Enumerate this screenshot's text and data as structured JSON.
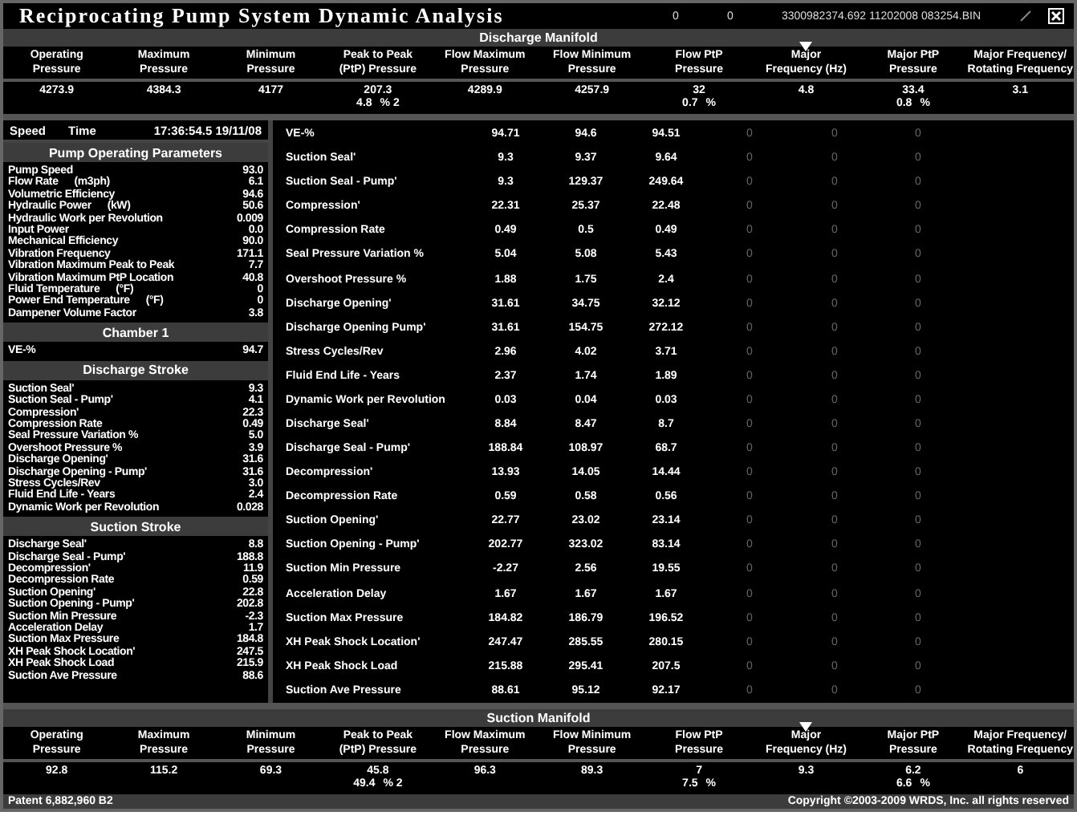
{
  "header": {
    "title": "Reciprocating Pump System Dynamic Analysis",
    "counter_1": "0",
    "counter_2": "0",
    "file": "3300982374.692 11202008 083254.BIN"
  },
  "discharge_manifold": {
    "title": "Discharge Manifold",
    "columns": [
      {
        "label": "Operating",
        "label_2": "Pressure",
        "marked": false,
        "value": "4273.9"
      },
      {
        "label": "Maximum",
        "label_2": "Pressure",
        "marked": false,
        "value": "4384.3"
      },
      {
        "label": "Minimum",
        "label_2": "Pressure",
        "marked": false,
        "value": "4177"
      },
      {
        "label": "Peak to Peak",
        "label_2": "(PtP) Pressure",
        "marked": false,
        "value": "207.3",
        "sub": "4.8",
        "sub_unit": "% 2"
      },
      {
        "label": "Flow Maximum",
        "label_2": "Pressure",
        "marked": false,
        "value": "4289.9"
      },
      {
        "label": "Flow Minimum",
        "label_2": "Pressure",
        "marked": false,
        "value": "4257.9"
      },
      {
        "label": "Flow PtP",
        "label_2": "Pressure",
        "marked": false,
        "value": "32",
        "sub": "0.7",
        "sub_unit": "%"
      },
      {
        "label": "Major",
        "label_2": "Frequency (Hz)",
        "marked": true,
        "value": "4.8"
      },
      {
        "label": "Major PtP",
        "label_2": "Pressure",
        "marked": false,
        "value": "33.4",
        "sub": "0.8",
        "sub_unit": "%"
      },
      {
        "label": "Major Frequency/",
        "label_2": "Rotating Frequency",
        "marked": false,
        "value": "3.1"
      }
    ]
  },
  "status": {
    "speed_label": "Speed",
    "time_label": "Time",
    "time": "17:36:54.5 19/11/08"
  },
  "sections": [
    {
      "title": "Pump Operating Parameters",
      "items": [
        {
          "name": "Pump Speed",
          "value": "93.0"
        },
        {
          "name": "Flow Rate",
          "unit": "(m3ph)",
          "value": "6.1"
        },
        {
          "name": "Volumetric Efficiency",
          "value": "94.6"
        },
        {
          "name": "Hydraulic Power",
          "unit": "(kW)",
          "value": "50.6"
        },
        {
          "name": "Hydraulic Work per Revolution",
          "value": "0.009"
        },
        {
          "name": "Input Power",
          "value": "0.0"
        },
        {
          "name": "Mechanical Efficiency",
          "value": "90.0"
        },
        {
          "name": "Vibration Frequency",
          "value": "171.1"
        },
        {
          "name": "Vibration Maximum Peak to Peak",
          "value": "7.7"
        },
        {
          "name": "Vibration Maximum PtP Location",
          "value": "40.8"
        },
        {
          "name": "Fluid Temperature",
          "unit": "(°F)",
          "value": "0"
        },
        {
          "name": "Power End Temperature",
          "unit": "(°F)",
          "value": "0"
        },
        {
          "name": "Dampener Volume Factor",
          "value": "3.8"
        }
      ]
    },
    {
      "title": "Chamber 1",
      "items": [
        {
          "name": "VE-%",
          "value": "94.7"
        }
      ]
    },
    {
      "title": "Discharge Stroke",
      "items": [
        {
          "name": "Suction Seal'",
          "value": "9.3"
        },
        {
          "name": "Suction Seal - Pump'",
          "value": "4.1"
        },
        {
          "name": "Compression'",
          "value": "22.3"
        },
        {
          "name": "Compression Rate",
          "value": "0.49"
        },
        {
          "name": "Seal Pressure Variation %",
          "value": "5.0"
        },
        {
          "name": "Overshoot Pressure %",
          "value": "3.9"
        },
        {
          "name": "Discharge Opening'",
          "value": "31.6"
        },
        {
          "name": "Discharge Opening - Pump'",
          "value": "31.6"
        },
        {
          "name": "Stress Cycles/Rev",
          "value": "3.0"
        },
        {
          "name": "Fluid End Life - Years",
          "value": "2.4"
        },
        {
          "name": "Dynamic Work per Revolution",
          "value": "0.028"
        }
      ]
    },
    {
      "title": "Suction Stroke",
      "items": [
        {
          "name": "Discharge Seal'",
          "value": "8.8"
        },
        {
          "name": "Discharge Seal - Pump'",
          "value": "188.8"
        },
        {
          "name": "Decompression'",
          "value": "11.9"
        },
        {
          "name": "Decompression Rate",
          "value": "0.59"
        },
        {
          "name": "Suction Opening'",
          "value": "22.8"
        },
        {
          "name": "Suction Opening - Pump'",
          "value": "202.8"
        },
        {
          "name": "Suction Min Pressure",
          "value": "-2.3"
        },
        {
          "name": "Acceleration Delay",
          "value": "1.7"
        },
        {
          "name": "Suction Max Pressure",
          "value": "184.8"
        },
        {
          "name": "XH Peak Shock Location'",
          "value": "247.5"
        },
        {
          "name": "XH Peak Shock Load",
          "value": "215.9"
        },
        {
          "name": "Suction Ave Pressure",
          "value": "88.6"
        }
      ]
    }
  ],
  "table_rows": [
    {
      "name": "VE-%",
      "values": [
        "94.71",
        "94.6",
        "94.51",
        "0",
        "0",
        "0"
      ]
    },
    {
      "name": "Suction Seal'",
      "values": [
        "9.3",
        "9.37",
        "9.64",
        "0",
        "0",
        "0"
      ]
    },
    {
      "name": "Suction Seal - Pump'",
      "values": [
        "9.3",
        "129.37",
        "249.64",
        "0",
        "0",
        "0"
      ]
    },
    {
      "name": "Compression'",
      "values": [
        "22.31",
        "25.37",
        "22.48",
        "0",
        "0",
        "0"
      ]
    },
    {
      "name": "Compression Rate",
      "values": [
        "0.49",
        "0.5",
        "0.49",
        "0",
        "0",
        "0"
      ]
    },
    {
      "name": "Seal Pressure Variation %",
      "values": [
        "5.04",
        "5.08",
        "5.43",
        "0",
        "0",
        "0"
      ]
    },
    {
      "name": "Overshoot Pressure %",
      "values": [
        "1.88",
        "1.75",
        "2.4",
        "0",
        "0",
        "0"
      ]
    },
    {
      "name": "Discharge Opening'",
      "values": [
        "31.61",
        "34.75",
        "32.12",
        "0",
        "0",
        "0"
      ]
    },
    {
      "name": "Discharge Opening Pump'",
      "values": [
        "31.61",
        "154.75",
        "272.12",
        "0",
        "0",
        "0"
      ]
    },
    {
      "name": "Stress Cycles/Rev",
      "values": [
        "2.96",
        "4.02",
        "3.71",
        "0",
        "0",
        "0"
      ]
    },
    {
      "name": "Fluid End Life - Years",
      "values": [
        "2.37",
        "1.74",
        "1.89",
        "0",
        "0",
        "0"
      ]
    },
    {
      "name": "Dynamic Work per Revolution",
      "values": [
        "0.03",
        "0.04",
        "0.03",
        "0",
        "0",
        "0"
      ]
    },
    {
      "name": "Discharge Seal'",
      "values": [
        "8.84",
        "8.47",
        "8.7",
        "0",
        "0",
        "0"
      ]
    },
    {
      "name": "Discharge Seal - Pump'",
      "values": [
        "188.84",
        "108.97",
        "68.7",
        "0",
        "0",
        "0"
      ]
    },
    {
      "name": "Decompression'",
      "values": [
        "13.93",
        "14.05",
        "14.44",
        "0",
        "0",
        "0"
      ]
    },
    {
      "name": "Decompression Rate",
      "values": [
        "0.59",
        "0.58",
        "0.56",
        "0",
        "0",
        "0"
      ]
    },
    {
      "name": "Suction Opening'",
      "values": [
        "22.77",
        "23.02",
        "23.14",
        "0",
        "0",
        "0"
      ]
    },
    {
      "name": "Suction Opening - Pump'",
      "values": [
        "202.77",
        "323.02",
        "83.14",
        "0",
        "0",
        "0"
      ]
    },
    {
      "name": "Suction Min Pressure",
      "values": [
        "-2.27",
        "2.56",
        "19.55",
        "0",
        "0",
        "0"
      ]
    },
    {
      "name": "Acceleration Delay",
      "values": [
        "1.67",
        "1.67",
        "1.67",
        "0",
        "0",
        "0"
      ]
    },
    {
      "name": "Suction Max Pressure",
      "values": [
        "184.82",
        "186.79",
        "196.52",
        "0",
        "0",
        "0"
      ]
    },
    {
      "name": "XH Peak Shock Location'",
      "values": [
        "247.47",
        "285.55",
        "280.15",
        "0",
        "0",
        "0"
      ]
    },
    {
      "name": "XH Peak Shock Load",
      "values": [
        "215.88",
        "295.41",
        "207.5",
        "0",
        "0",
        "0"
      ]
    },
    {
      "name": "Suction Ave Pressure",
      "values": [
        "88.61",
        "95.12",
        "92.17",
        "0",
        "0",
        "0"
      ]
    }
  ],
  "suction_manifold": {
    "title": "Suction Manifold",
    "columns": [
      {
        "label": "Operating",
        "label_2": "Pressure",
        "marked": false,
        "value": "92.8"
      },
      {
        "label": "Maximum",
        "label_2": "Pressure",
        "marked": false,
        "value": "115.2"
      },
      {
        "label": "Minimum",
        "label_2": "Pressure",
        "marked": false,
        "value": "69.3"
      },
      {
        "label": "Peak to Peak",
        "label_2": "(PtP) Pressure",
        "marked": false,
        "value": "45.8",
        "sub": "49.4",
        "sub_unit": "% 2"
      },
      {
        "label": "Flow Maximum",
        "label_2": "Pressure",
        "marked": false,
        "value": "96.3"
      },
      {
        "label": "Flow Minimum",
        "label_2": "Pressure",
        "marked": false,
        "value": "89.3"
      },
      {
        "label": "Flow PtP",
        "label_2": "Pressure",
        "marked": false,
        "value": "7",
        "sub": "7.5",
        "sub_unit": "%"
      },
      {
        "label": "Major",
        "label_2": "Frequency (Hz)",
        "marked": true,
        "value": "9.3"
      },
      {
        "label": "Major PtP",
        "label_2": "Pressure",
        "marked": false,
        "value": "6.2",
        "sub": "6.6",
        "sub_unit": "%"
      },
      {
        "label": "Major Frequency/",
        "label_2": "Rotating Frequency",
        "marked": false,
        "value": "6"
      }
    ]
  },
  "footer": {
    "patent": "Patent 6,882,960 B2",
    "copyright": "Copyright ©2003-2009 WRDS, Inc. all rights reserved"
  }
}
